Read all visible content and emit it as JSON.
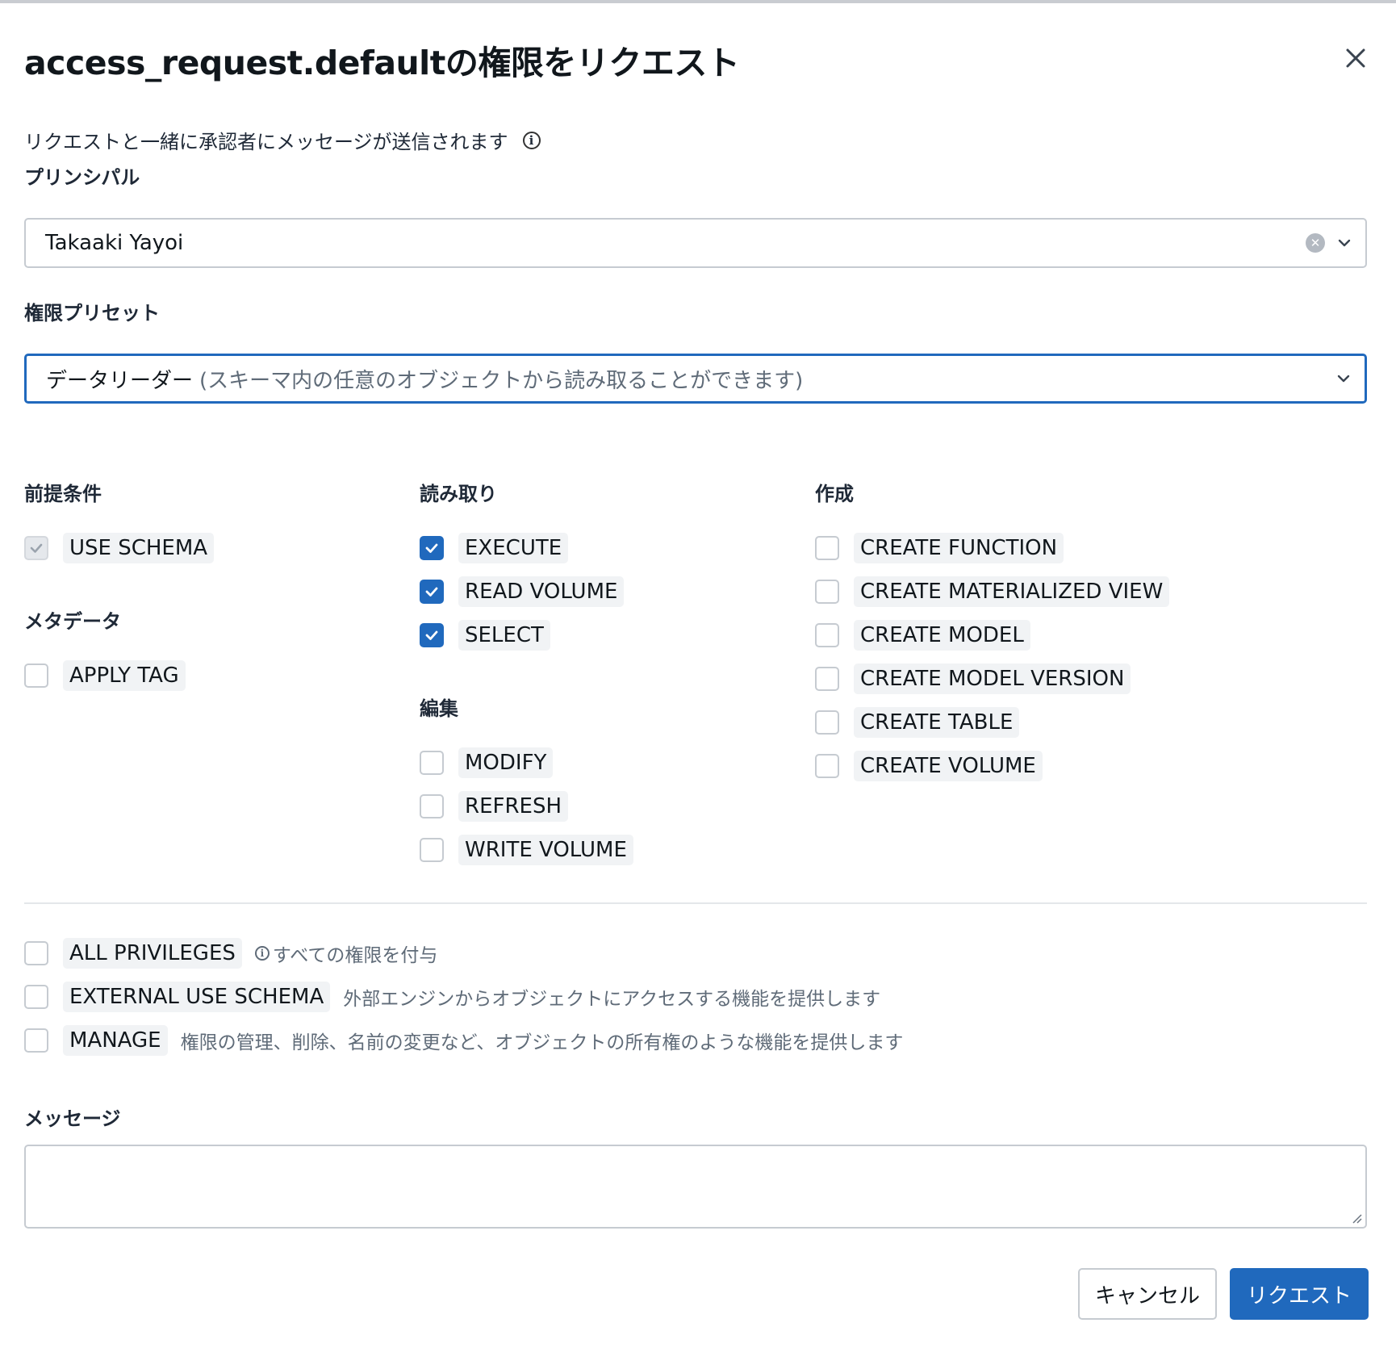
{
  "dialog": {
    "title": "access_request.defaultの権限をリクエスト",
    "note": "リクエストと一緒に承認者にメッセージが送信されます"
  },
  "principal": {
    "label": "プリンシパル",
    "value": "Takaaki Yayoi"
  },
  "preset": {
    "label": "権限プリセット",
    "value": "データリーダー",
    "description": "(スキーマ内の任意のオブジェクトから読み取ることができます)"
  },
  "groups": {
    "prereq": {
      "title": "前提条件",
      "items": [
        {
          "label": "USE SCHEMA",
          "checked": true,
          "disabled": true
        }
      ]
    },
    "metadata": {
      "title": "メタデータ",
      "items": [
        {
          "label": "APPLY TAG",
          "checked": false
        }
      ]
    },
    "read": {
      "title": "読み取り",
      "items": [
        {
          "label": "EXECUTE",
          "checked": true
        },
        {
          "label": "READ VOLUME",
          "checked": true
        },
        {
          "label": "SELECT",
          "checked": true
        }
      ]
    },
    "edit": {
      "title": "編集",
      "items": [
        {
          "label": "MODIFY",
          "checked": false
        },
        {
          "label": "REFRESH",
          "checked": false
        },
        {
          "label": "WRITE VOLUME",
          "checked": false
        }
      ]
    },
    "create": {
      "title": "作成",
      "items": [
        {
          "label": "CREATE FUNCTION",
          "checked": false
        },
        {
          "label": "CREATE MATERIALIZED VIEW",
          "checked": false
        },
        {
          "label": "CREATE MODEL",
          "checked": false
        },
        {
          "label": "CREATE MODEL VERSION",
          "checked": false
        },
        {
          "label": "CREATE TABLE",
          "checked": false
        },
        {
          "label": "CREATE VOLUME",
          "checked": false
        }
      ]
    }
  },
  "special": [
    {
      "label": "ALL PRIVILEGES",
      "description": "すべての権限を付与",
      "checked": false
    },
    {
      "label": "EXTERNAL USE SCHEMA",
      "description": "外部エンジンからオブジェクトにアクセスする機能を提供します",
      "checked": false
    },
    {
      "label": "MANAGE",
      "description": "権限の管理、削除、名前の変更など、オブジェクトの所有権のような機能を提供します",
      "checked": false
    }
  ],
  "message": {
    "label": "メッセージ",
    "value": ""
  },
  "buttons": {
    "cancel": "キャンセル",
    "submit": "リクエスト"
  },
  "colors": {
    "primary": "#2069bd",
    "border": "#c6cbd1",
    "tag_bg": "#f1f3f5"
  }
}
